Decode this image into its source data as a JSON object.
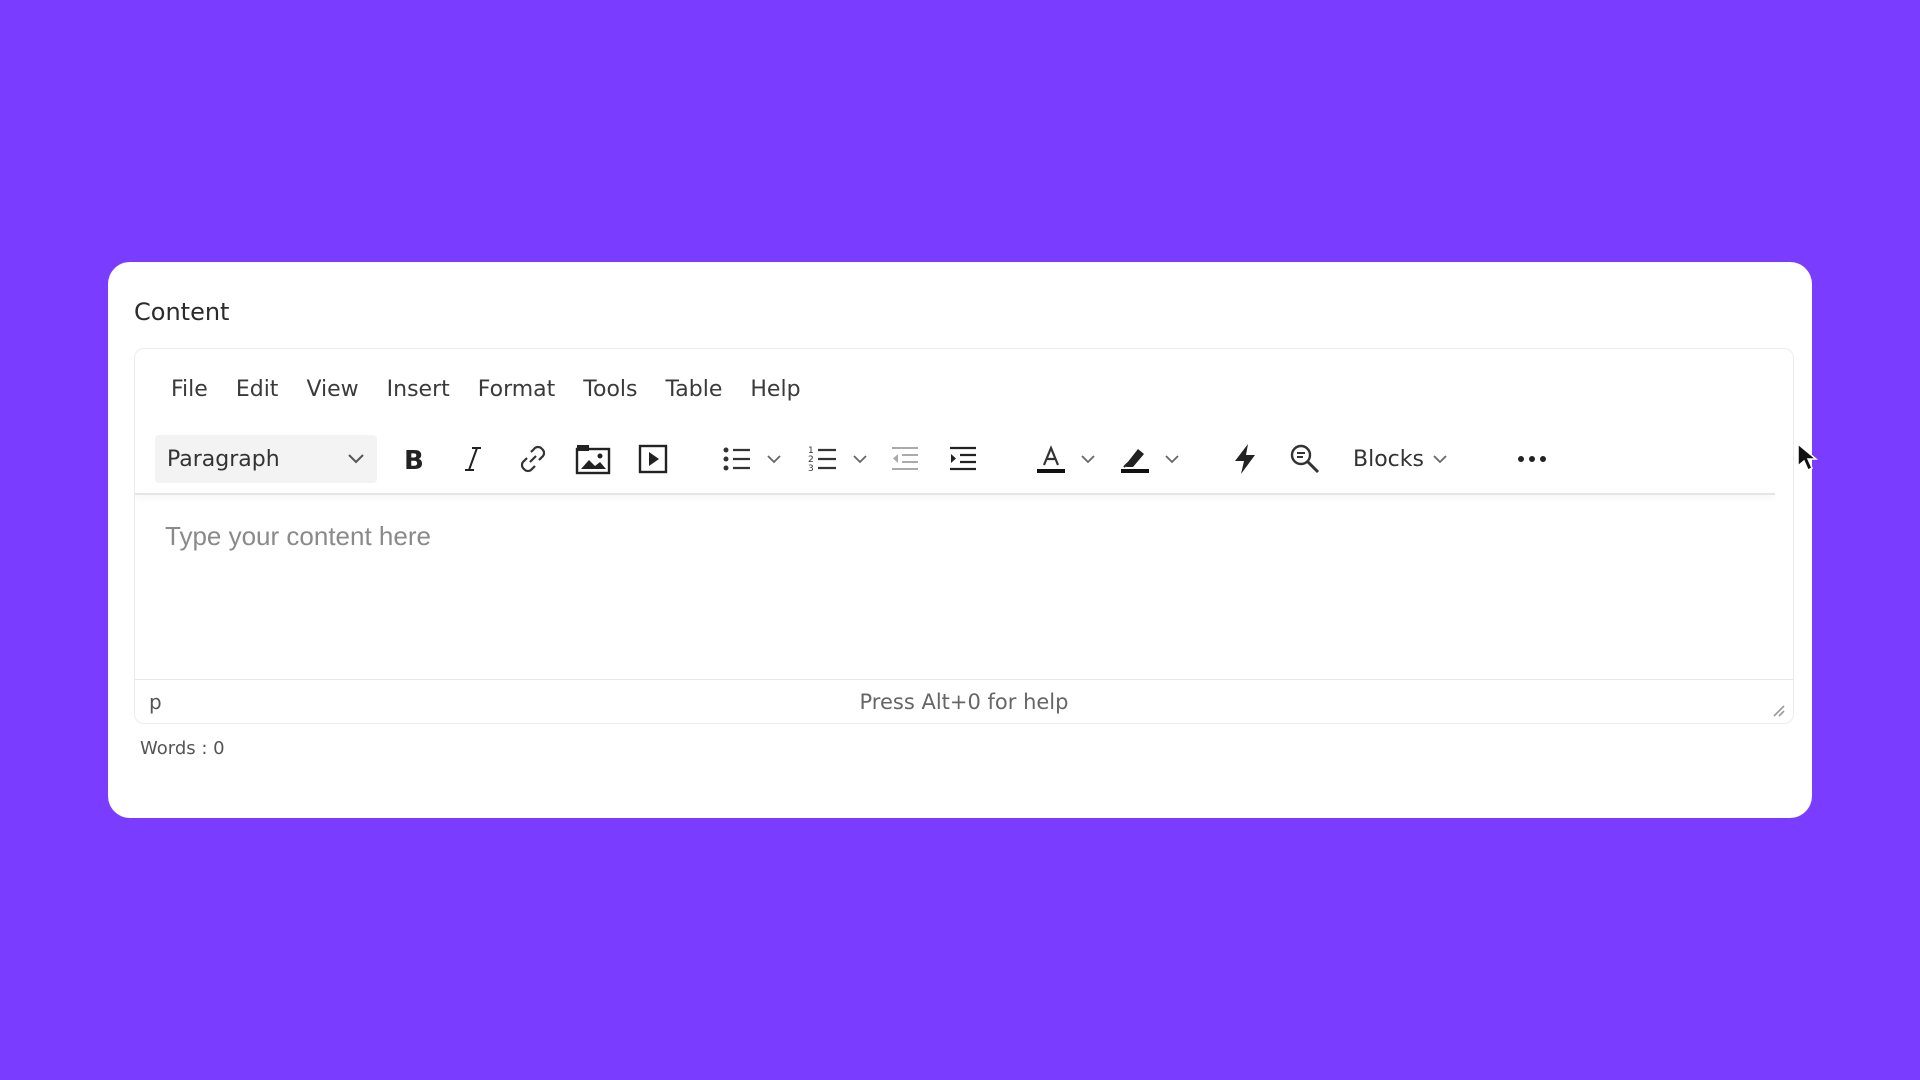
{
  "card": {
    "title": "Content"
  },
  "menubar": {
    "items": [
      "File",
      "Edit",
      "View",
      "Insert",
      "Format",
      "Tools",
      "Table",
      "Help"
    ]
  },
  "toolbar": {
    "block_format": "Paragraph",
    "blocks_label": "Blocks",
    "icons": [
      "bold-icon",
      "italic-icon",
      "link-icon",
      "image-icon",
      "media-icon",
      "bullet-list-icon",
      "numbered-list-icon",
      "outdent-icon",
      "indent-icon",
      "text-color-icon",
      "highlight-icon",
      "lightning-icon",
      "find-replace-icon",
      "more-icon"
    ]
  },
  "editor": {
    "placeholder": "Type your content here"
  },
  "statusbar": {
    "path": "p",
    "help": "Press Alt+0 for help"
  },
  "word_count": "Words : 0",
  "colors": {
    "background": "#7a3cff",
    "card": "#ffffff",
    "text_color_underline": "#111111"
  }
}
